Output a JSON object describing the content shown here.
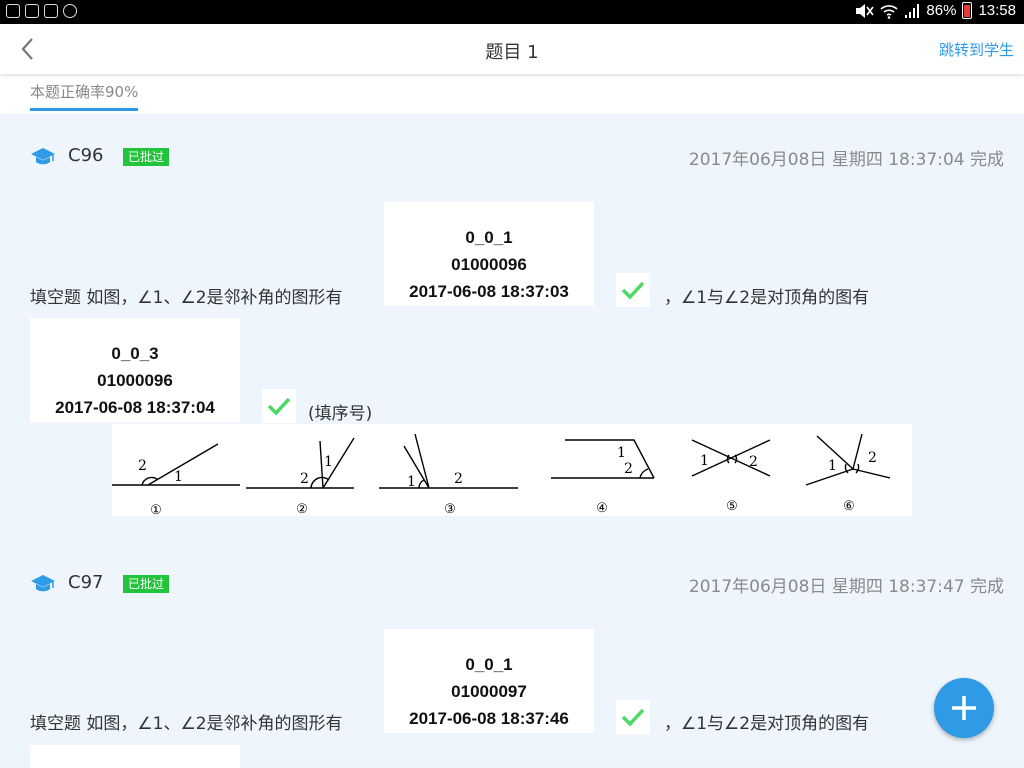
{
  "status_bar": {
    "battery": "86%",
    "time": "13:58"
  },
  "nav": {
    "title": "题目 1",
    "jump_label": "跳转到学生"
  },
  "tabs": [
    {
      "label": "本题正确率90%"
    }
  ],
  "question_text": {
    "prefix": "填空题  如图，∠1、∠2是邻补角的图形有",
    "middle": "，∠1与∠2是对顶角的图有",
    "suffix": "(填序号)"
  },
  "figure": {
    "labels": [
      "①",
      "②",
      "③",
      "④",
      "⑤",
      "⑥"
    ],
    "angle_1": "1",
    "angle_2": "2"
  },
  "submissions": [
    {
      "student": "C96",
      "status": "已批过",
      "time": "2017年06月08日 星期四 18:37:04 完成",
      "answers": [
        {
          "code": "0_0_1",
          "id": "01000096",
          "timestamp": "2017-06-08 18:37:03"
        },
        {
          "code": "0_0_3",
          "id": "01000096",
          "timestamp": "2017-06-08 18:37:04"
        }
      ]
    },
    {
      "student": "C97",
      "status": "已批过",
      "time": "2017年06月08日 星期四 18:37:47 完成",
      "answers": [
        {
          "code": "0_0_1",
          "id": "01000097",
          "timestamp": "2017-06-08 18:37:46"
        }
      ]
    }
  ],
  "colors": {
    "accent": "#2f9ae6",
    "badge": "#21c43a",
    "check": "#4cd964",
    "background": "#eef5fc"
  },
  "icons": {
    "back": "chevron-left-icon",
    "student": "graduation-cap-icon",
    "correct": "check-icon",
    "fab": "plus-icon"
  }
}
